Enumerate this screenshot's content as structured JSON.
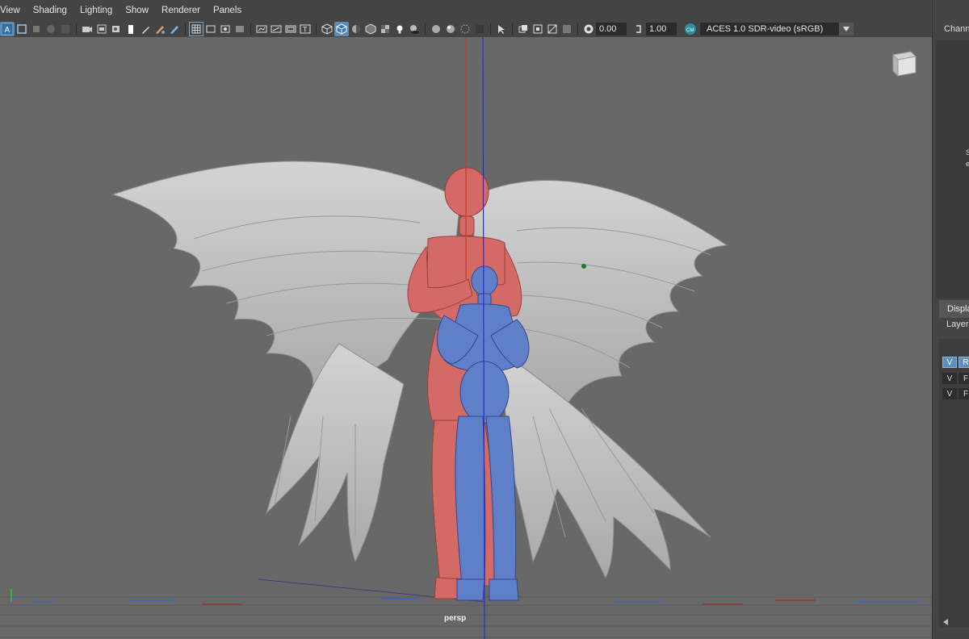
{
  "menubar": {
    "items": [
      "View",
      "Shading",
      "Lighting",
      "Show",
      "Renderer",
      "Panels"
    ]
  },
  "toolbar": {
    "exposure_value": "0.00",
    "gamma_value": "1.00",
    "color_space": "ACES 1.0 SDR-video (sRGB)",
    "accent_color": "#5d8db4"
  },
  "viewport": {
    "camera_label": "persp",
    "background_color": "#686868",
    "objects": [
      {
        "name": "angel-wings",
        "color": "#c4c4c4"
      },
      {
        "name": "red-mannequin",
        "color": "#d46a65"
      },
      {
        "name": "blue-mannequin",
        "color": "#5f7fc8"
      }
    ]
  },
  "right_panel": {
    "channel_box_label": "Channe",
    "display_tab": "Display",
    "layers_label": "Layers",
    "layer_rows": [
      {
        "visibility": "V",
        "type": "R"
      },
      {
        "visibility": "V",
        "type": "F"
      },
      {
        "visibility": "V",
        "type": "F"
      }
    ],
    "truncated_s": "S",
    "truncated_e": "e"
  }
}
